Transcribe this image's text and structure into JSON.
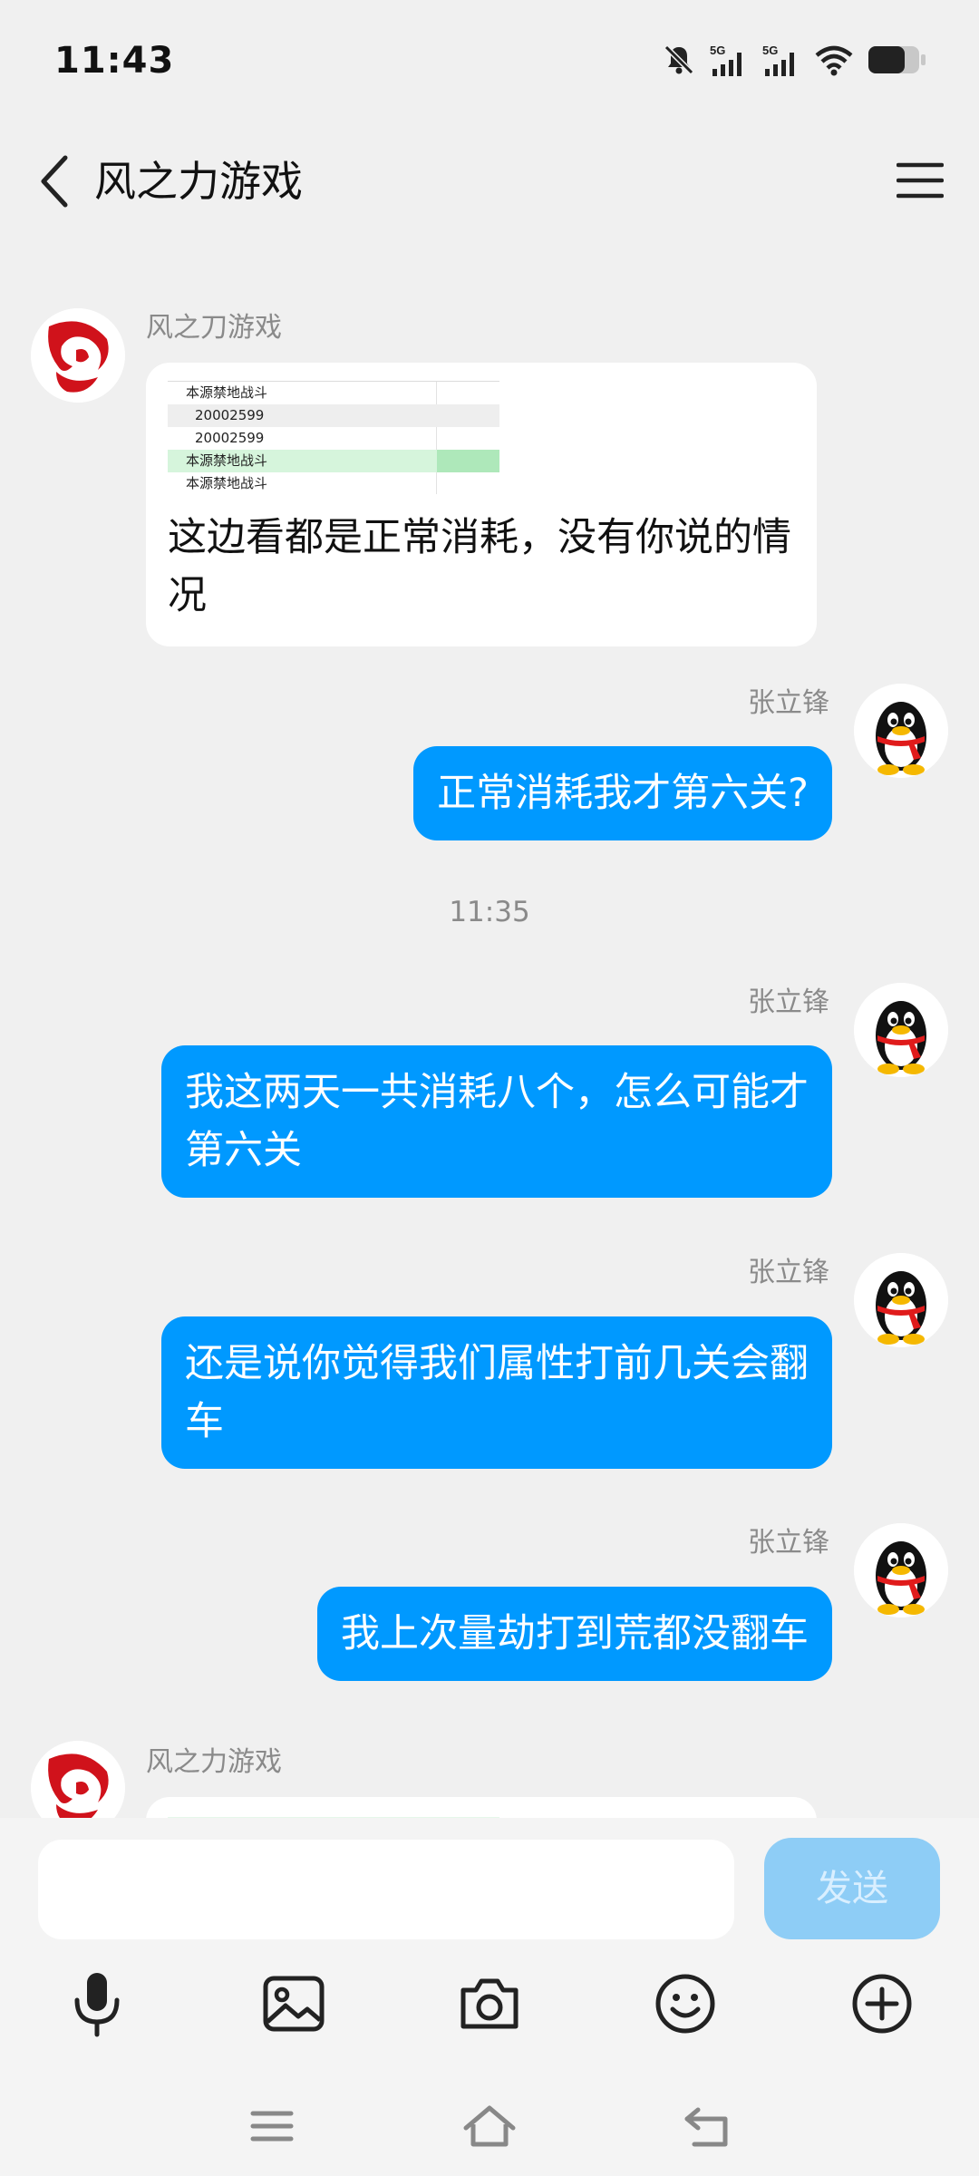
{
  "status_bar": {
    "time": "11:43",
    "signal_1": "5G",
    "signal_2": "5G"
  },
  "header": {
    "title": "风之力游戏",
    "back_icon": "chevron-left-icon",
    "menu_icon": "hamburger-menu-icon"
  },
  "colors": {
    "accent": "#0099ff",
    "background": "#f0f0f0",
    "send_disabled": "#8ecdf6"
  },
  "image_table": {
    "rows": [
      "本源禁地战斗",
      "20002599",
      "20002599",
      "本源禁地战斗",
      "本源禁地战斗"
    ]
  },
  "messages": [
    {
      "direction": "in",
      "sender": "风之刀游戏",
      "text": "这边看都是正常消耗，没有你说的情况"
    },
    {
      "direction": "out",
      "sender": "张立锋",
      "text": "正常消耗我才第六关?"
    },
    {
      "direction": "out",
      "sender": "张立锋",
      "text": "我这两天一共消耗八个，怎么可能才第六关"
    },
    {
      "direction": "out",
      "sender": "张立锋",
      "text": "还是说你觉得我们属性打前几关会翻车"
    },
    {
      "direction": "out",
      "sender": "张立锋",
      "text": "我上次量劫打到荒都没翻车"
    },
    {
      "direction": "in",
      "sender": "风之力游戏"
    }
  ],
  "timestamp": "11:35",
  "input": {
    "value": "",
    "placeholder": "",
    "send_label": "发送"
  },
  "toolbar": [
    "microphone-icon",
    "image-icon",
    "camera-icon",
    "emoji-icon",
    "plus-icon"
  ],
  "nav": [
    "menu-icon",
    "home-icon",
    "back-icon"
  ]
}
